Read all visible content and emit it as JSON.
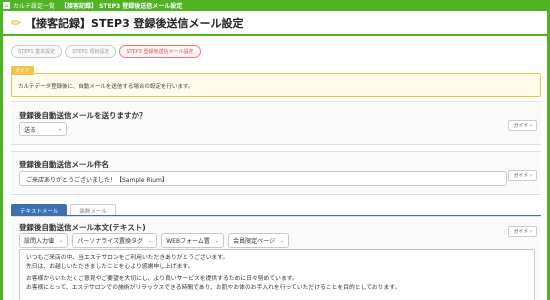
{
  "topbar": {
    "home_icon": "home-icon",
    "crumbs": [
      "カルテ設定一覧",
      "【接客記録】 STEP3 登録後送信メール設定"
    ]
  },
  "title": "【接客記録】STEP3 登録後送信メール設定",
  "steps": [
    "STEP1 基本設定",
    "STEP2 項目設定",
    "STEP3 登録後送信メール設定"
  ],
  "guide": {
    "tag": "ガイド",
    "text": "カルテデータ登録後に、自動メールを送信する場合の設定を行います。"
  },
  "send_section": {
    "label": "登録後自動送信メールを送りますか？",
    "select_value": "送る",
    "guide_button": "ガイド"
  },
  "subject_section": {
    "label": "登録後自動送信メール件名",
    "value": "ご来店ありがとうございました！【Sample Rium】",
    "guide_button": "ガイド"
  },
  "tabs": [
    "テキストメール",
    "装飾メール"
  ],
  "body_section": {
    "label": "登録後自動送信メール本文(テキスト)",
    "guide_button": "ガイド",
    "toolbar": [
      "設問入力値",
      "パーソナライズ置換タグ",
      "WEBフォーム置",
      "会員限定ページ"
    ],
    "lines": [
      "いつもご来店の中、当エステサロンをご利用いただきありがとうございます。",
      "先日は、お越しいただきましたことを心より感謝申し上げます。",
      "",
      "お客様からいただくご意見やご要望を大切にし、より良いサービスを提供するために日々努めています。",
      "お客様にとって、エステサロンでの施術がリラックスできる時間であり、お肌やお体のお手入れを行っていただけることを目的としております。"
    ]
  },
  "colors": {
    "brand_green": "#4fb324",
    "tab_blue": "#3d6fb3",
    "guide_yellow": "#f3c34a"
  }
}
